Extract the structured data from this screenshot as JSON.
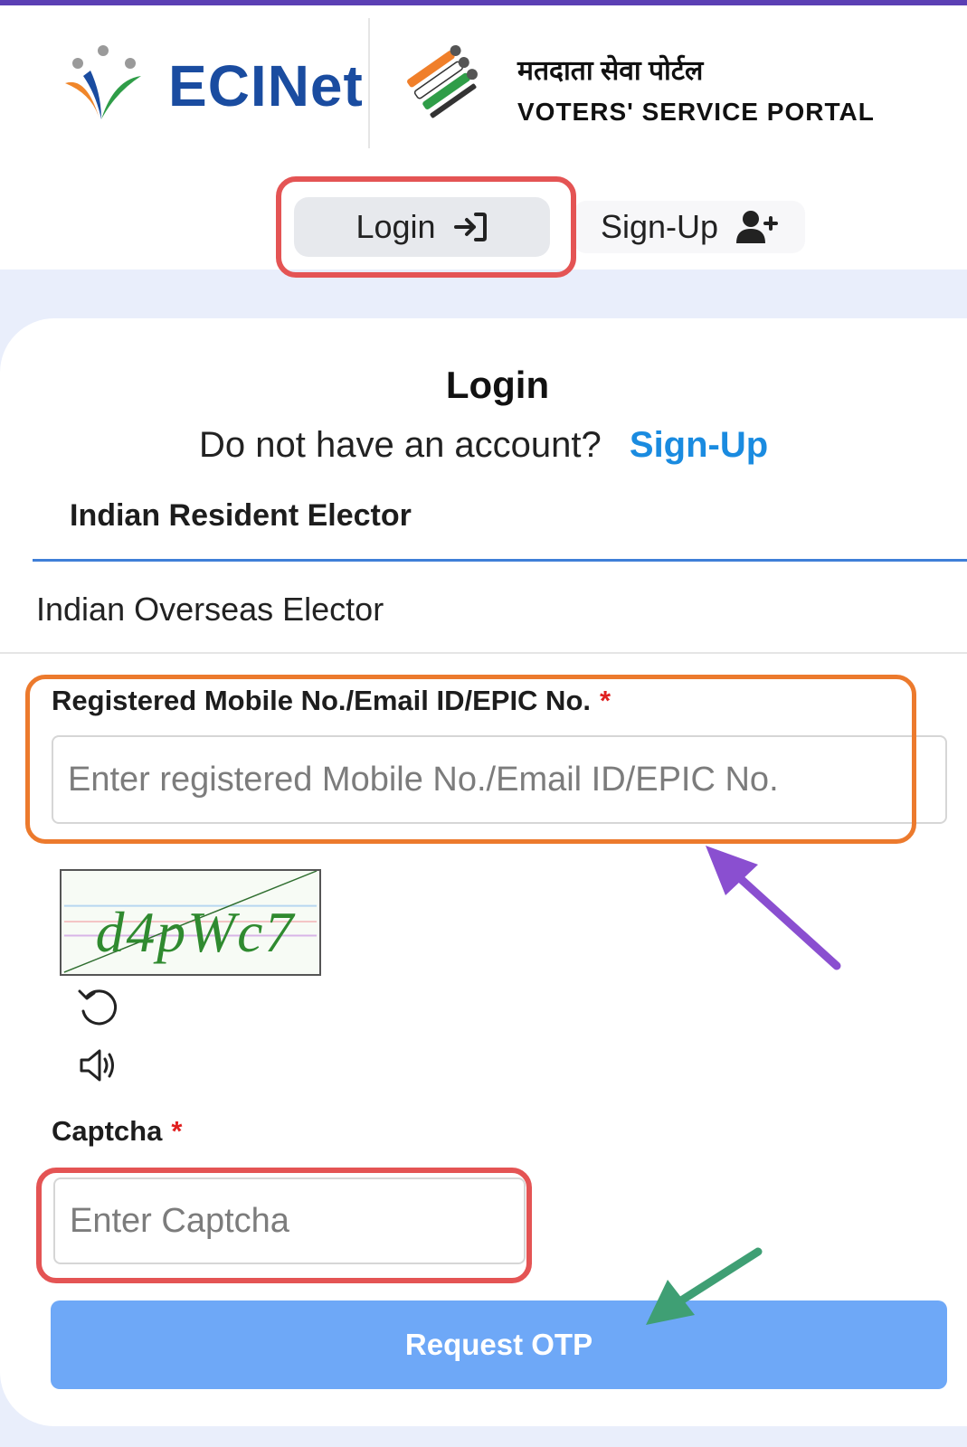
{
  "header": {
    "brand_name": "ECINet",
    "portal_title_hindi": "मतदाता सेवा पोर्टल",
    "portal_title_english": "VOTERS' SERVICE PORTAL"
  },
  "top_tabs": {
    "login_label": "Login",
    "signup_label": "Sign-Up",
    "active": "Login"
  },
  "login_card": {
    "title": "Login",
    "no_account_text": "Do not have an account?",
    "signup_link": "Sign-Up",
    "elector_tabs": [
      {
        "label": "Indian Resident Elector",
        "selected": true
      },
      {
        "label": "Indian Overseas Elector",
        "selected": false
      }
    ]
  },
  "form": {
    "mobile": {
      "label": "Registered Mobile No./Email ID/EPIC No.",
      "required_mark": "*",
      "placeholder": "Enter registered Mobile No./Email ID/EPIC No.",
      "value": ""
    },
    "captcha_image_text": "d4pWc7",
    "captcha": {
      "label": "Captcha",
      "required_mark": "*",
      "placeholder": "Enter Captcha",
      "value": ""
    },
    "submit_label": "Request OTP"
  },
  "icons": {
    "login_tab": "sign-in-arrow-icon",
    "signup_tab": "user-plus-icon",
    "captcha_refresh": "refresh-icon",
    "captcha_audio": "speaker-icon"
  },
  "colors": {
    "brand_blue": "#1a4ca0",
    "link_blue": "#1a8be0",
    "button_blue": "#6ea8f7",
    "tab_underline": "#3f7fd8",
    "highlight_red": "#e45454",
    "highlight_orange": "#ec7a2d",
    "arrow_purple": "#8a4fd0",
    "arrow_green": "#3f9f74",
    "required_red": "#e02020",
    "top_bar": "#5b3fb4"
  }
}
